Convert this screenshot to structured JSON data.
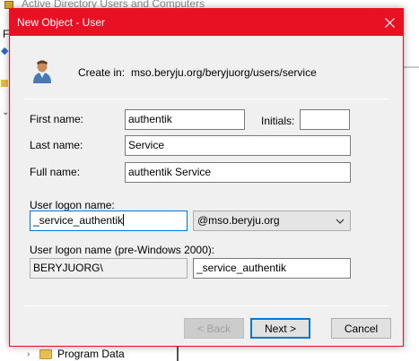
{
  "background_window": {
    "title": "Active Directory Users and Computers",
    "menu_first": "F",
    "tree_item_label": "Program Data"
  },
  "dialog": {
    "title": "New Object - User",
    "create_in_label": "Create in:",
    "create_in_path": "mso.beryju.org/beryjuorg/users/service",
    "first_name_label": "First name:",
    "first_name_value": "authentik",
    "initials_label": "Initials:",
    "initials_value": "",
    "last_name_label": "Last name:",
    "last_name_value": "Service",
    "full_name_label": "Full name:",
    "full_name_value": "authentik Service",
    "logon_name_label": "User logon name:",
    "logon_name_value": "_service_authentik",
    "upn_suffix": "@mso.beryju.org",
    "pre2000_label": "User logon name (pre-Windows 2000):",
    "pre2000_domain": "BERYJUORG\\",
    "pre2000_name": "_service_authentik",
    "back_label": "< Back",
    "next_label": "Next >",
    "cancel_label": "Cancel"
  },
  "colors": {
    "titlebar": "#e81123",
    "focus_border": "#0078d7"
  },
  "icons": {
    "close": "close-icon",
    "user": "user-icon",
    "dropdown": "chevron-down-icon",
    "folder": "folder-icon"
  }
}
